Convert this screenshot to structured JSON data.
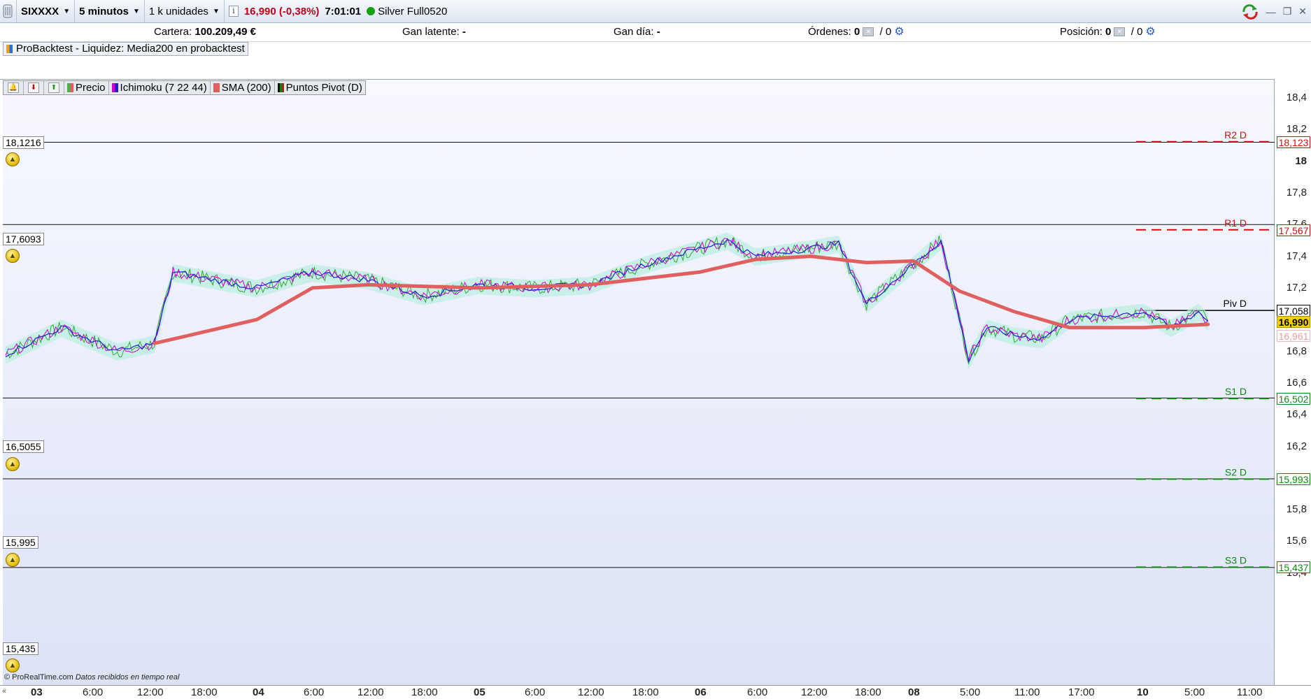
{
  "toolbar": {
    "instrument": "SIXXXX",
    "timeframe": "5 minutos",
    "units": "1 k unidades",
    "info": "i",
    "price": "16,990 (-0,38%)",
    "time": "7:01:01",
    "account": "Silver Full0520"
  },
  "account_bar": {
    "cartera_label": "Cartera:",
    "cartera_value": "100.209,49 €",
    "gan_latente_label": "Gan latente:",
    "gan_latente_value": "-",
    "gan_dia_label": "Gan día:",
    "gan_dia_value": "-",
    "ordenes_label": "Órdenes:",
    "ordenes_value": "0",
    "ordenes_total": "/ 0",
    "posicion_label": "Posición:",
    "posicion_value": "0",
    "posicion_total": "/ 0"
  },
  "probacktest": "ProBacktest - Liquidez: Media200 en probacktest",
  "indicators": [
    {
      "label": "Precio",
      "color": "#4caf50"
    },
    {
      "label": "Ichimoku (7 22 44)",
      "color": "#d000d0"
    },
    {
      "label": "SMA (200)",
      "color": "#e06060"
    },
    {
      "label": "Puntos Pivot (D)",
      "color": "#1a7a1a"
    }
  ],
  "level_values": [
    "18,1216",
    "17,6093",
    "16,5055",
    "15,995",
    "15,435"
  ],
  "pivot_labels": [
    {
      "name": "R2 D",
      "value": "18,123",
      "color": "#d01010"
    },
    {
      "name": "R1 D",
      "value": "17,567",
      "color": "#d01010"
    },
    {
      "name": "Piv D",
      "value": "17,058",
      "color": "#000000"
    },
    {
      "name": "S1 D",
      "value": "16,502",
      "color": "#118811"
    },
    {
      "name": "S2 D",
      "value": "15,993",
      "color": "#118811"
    },
    {
      "name": "S3 D",
      "value": "15,437",
      "color": "#118811"
    }
  ],
  "current_price": "16,990",
  "sma_value": "16,961",
  "y_ticks": [
    "18,4",
    "18,2",
    "18",
    "17,8",
    "17,6",
    "17,4",
    "17,2",
    "17",
    "16,8",
    "16,6",
    "16,4",
    "16,2",
    "16",
    "15,8",
    "15,6",
    "15,4"
  ],
  "x_ticks": [
    "03",
    "6:00",
    "12:00",
    "18:00",
    "04",
    "6:00",
    "12:00",
    "18:00",
    "05",
    "6:00",
    "12:00",
    "18:00",
    "06",
    "6:00",
    "12:00",
    "18:00",
    "08",
    "5:00",
    "11:00",
    "17:00",
    "10",
    "5:00",
    "11:00"
  ],
  "footer": {
    "copyright": "© ProRealTime.com",
    "note": "Datos recibidos en tiempo real"
  },
  "chart_data": {
    "type": "line",
    "title": "",
    "series": [
      {
        "name": "Precio",
        "x": [
          "03 0:00",
          "03 6:00",
          "03 12:00",
          "03 16:00",
          "03 18:00",
          "04 0:00",
          "04 6:00",
          "04 12:00",
          "04 18:00",
          "05 0:00",
          "05 6:00",
          "05 12:00",
          "05 18:00",
          "06 0:00",
          "06 3:00",
          "06 6:00",
          "06 12:00",
          "06 15:00",
          "06 18:00",
          "08 0:00",
          "08 3:00",
          "08 5:00",
          "08 6:00",
          "08 8:00",
          "08 11:00",
          "08 14:00",
          "08 17:00",
          "10 0:00",
          "10 3:00",
          "10 6:00",
          "10 7:00"
        ],
        "values": [
          16.78,
          16.95,
          16.8,
          16.85,
          17.3,
          17.2,
          17.3,
          17.25,
          17.15,
          17.22,
          17.2,
          17.22,
          17.35,
          17.45,
          17.5,
          17.4,
          17.45,
          17.48,
          17.1,
          17.35,
          17.5,
          17.0,
          16.75,
          16.95,
          16.9,
          16.88,
          17.0,
          17.05,
          16.95,
          17.05,
          16.99
        ]
      },
      {
        "name": "SMA (200)",
        "x": [
          "03 16:00",
          "04 0:00",
          "04 6:00",
          "04 12:00",
          "05 0:00",
          "05 12:00",
          "06 0:00",
          "06 6:00",
          "06 12:00",
          "06 18:00",
          "08 0:00",
          "08 5:00",
          "08 11:00",
          "08 17:00",
          "10 0:00",
          "10 7:00"
        ],
        "values": [
          16.85,
          17.0,
          17.2,
          17.22,
          17.2,
          17.22,
          17.3,
          17.38,
          17.4,
          17.36,
          17.37,
          17.18,
          17.05,
          16.95,
          16.95,
          16.97
        ]
      }
    ],
    "ylim": [
      15.4,
      18.45
    ],
    "grid": false
  }
}
